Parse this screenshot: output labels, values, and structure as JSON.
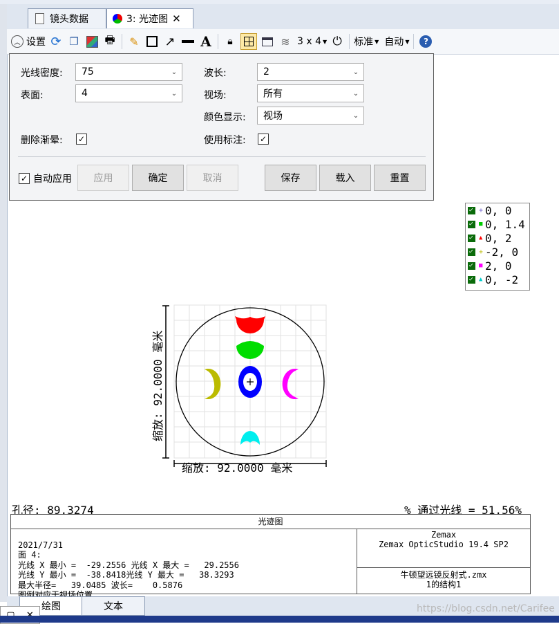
{
  "tabs": [
    {
      "label": "镜头数据",
      "active": false
    },
    {
      "label": "3: 光迹图",
      "active": true
    }
  ],
  "toolbar": {
    "settings_label": "设置",
    "layout_label": "3 x 4",
    "standard_label": "标准",
    "auto_label": "自动"
  },
  "settings": {
    "ray_density_label": "光线密度:",
    "ray_density_value": "75",
    "surface_label": "表面:",
    "surface_value": "4",
    "wavelength_label": "波长:",
    "wavelength_value": "2",
    "field_label": "视场:",
    "field_value": "所有",
    "color_label": "颜色显示:",
    "color_value": "视场",
    "delete_vignetting_label": "删除渐晕:",
    "use_annotation_label": "使用标注:",
    "auto_apply_label": "自动应用",
    "apply_label": "应用",
    "ok_label": "确定",
    "cancel_label": "取消",
    "save_label": "保存",
    "load_label": "载入",
    "reset_label": "重置"
  },
  "legend": [
    {
      "label": "0, 0",
      "color": "#6a5acd",
      "marker": "+"
    },
    {
      "label": "0, 1.4",
      "color": "#00cc00",
      "marker": "■"
    },
    {
      "label": "0, 2",
      "color": "#ff0000",
      "marker": "▲"
    },
    {
      "label": "-2, 0",
      "color": "#bbbb00",
      "marker": "+"
    },
    {
      "label": "2, 0",
      "color": "#ff00ff",
      "marker": "■"
    },
    {
      "label": "0, -2",
      "color": "#00cccc",
      "marker": "▲"
    }
  ],
  "plot": {
    "y_scale_label": "缩放: 92.0000 毫米",
    "x_scale_label": "缩放: 92.0000 毫米",
    "aperture_label": "孔径: 89.3274",
    "rays_through_label": "% 通过光线 = 51.56%"
  },
  "info": {
    "title": "光迹图",
    "date": "2021/7/31",
    "surface_line": "面 4:",
    "x_line": "光线 X 最小 =  -29.2556 光线 X 最大 =   29.2556",
    "y_line": "光线 Y 最小 =  -38.8418光线 Y 最大 =   38.3293",
    "radius_line": "最大半径=   39.0485 波长=    0.5876",
    "legend_note": "图例对应于视场位置",
    "vendor": "Zemax",
    "product": "Zemax OpticStudio 19.4 SP2",
    "file": "牛顿望远镜反射式.zmx",
    "config": "1的结构1"
  },
  "bottom_tabs": [
    {
      "label": "绘图",
      "active": true
    },
    {
      "label": "文本",
      "active": false
    }
  ],
  "watermark": "https://blog.csdn.net/Carifee",
  "colors": {
    "field1": "#0000ff",
    "field2": "#00dd00",
    "field3": "#ff0000",
    "field4": "#bbbb00",
    "field5": "#ff00ff",
    "field6": "#00eeee"
  }
}
